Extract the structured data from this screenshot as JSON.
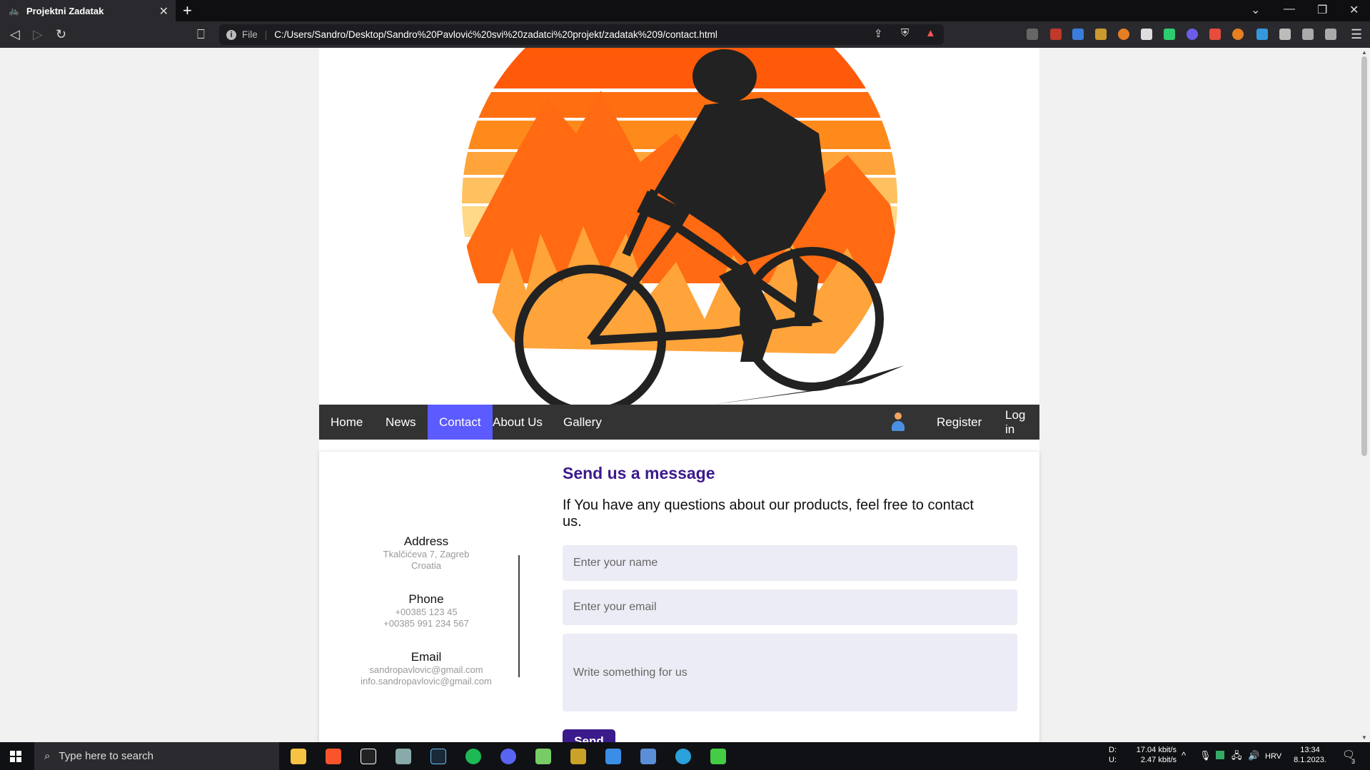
{
  "browser": {
    "tab_title": "Projektni Zadatak",
    "tab_close": "✕",
    "new_tab": "+",
    "address_label": "File",
    "url": "C:/Users/Sandro/Desktop/Sandro%20Pavlović%20svi%20zadatci%20projekt/zadatak%209/contact.html"
  },
  "nav": {
    "items": [
      "Home",
      "News",
      "Contact",
      "About Us",
      "Gallery"
    ],
    "active": "Contact",
    "register": "Register",
    "login": "Log in"
  },
  "contact_info": {
    "address": {
      "title": "Address",
      "lines": [
        "Tkalčićeva 7, Zagreb",
        "Croatia"
      ]
    },
    "phone": {
      "title": "Phone",
      "lines": [
        "+00385 123 45",
        "+00385 991 234 567"
      ]
    },
    "email": {
      "title": "Email",
      "lines": [
        "sandropavlovic@gmail.com",
        "info.sandropavlovic@gmail.com"
      ]
    }
  },
  "form": {
    "title": "Send us a message",
    "subtitle": "If You have any questions about our products, feel free to contact us.",
    "name_placeholder": "Enter your name",
    "email_placeholder": "Enter your email",
    "message_placeholder": "Write something for us",
    "send_label": "Send"
  },
  "taskbar": {
    "search_placeholder": "Type here to search",
    "net_down_label": "D:",
    "net_up_label": "U:",
    "net_down": "17.04 kbit/s",
    "net_up": "2.47 kbit/s",
    "language": "HRV",
    "time": "13:34",
    "date": "8.1.2023.",
    "notifications": "3"
  },
  "colors": {
    "accent": "#5b5bff",
    "title": "#3b1a8c",
    "nav_bg": "#333333"
  }
}
